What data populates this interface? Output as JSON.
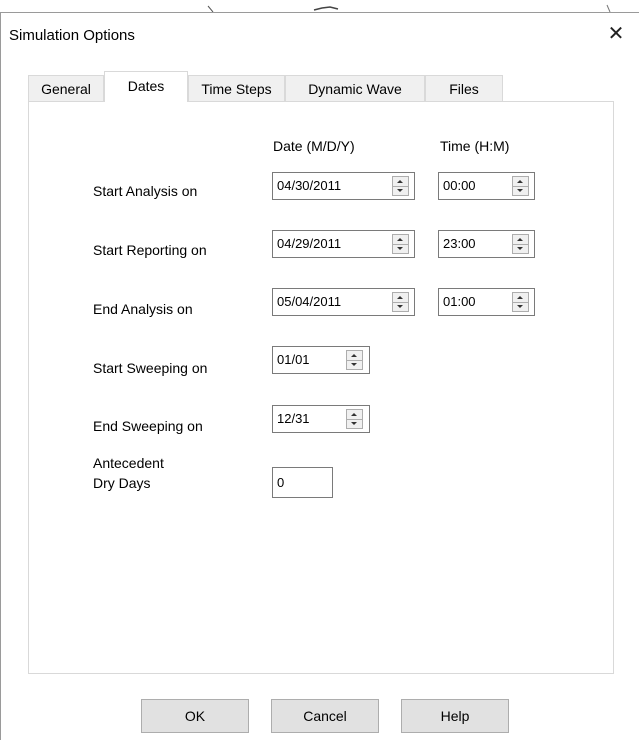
{
  "window": {
    "title": "Simulation Options",
    "close_glyph": "✕"
  },
  "tabs": [
    {
      "label": "General"
    },
    {
      "label": "Dates",
      "active": true
    },
    {
      "label": "Time Steps"
    },
    {
      "label": "Dynamic Wave"
    },
    {
      "label": "Files"
    }
  ],
  "dates": {
    "date_header": "Date (M/D/Y)",
    "time_header": "Time (H:M)",
    "start_analysis": {
      "label": "Start Analysis on",
      "date": "04/30/2011",
      "time": "00:00"
    },
    "start_reporting": {
      "label": "Start Reporting on",
      "date": "04/29/2011",
      "time": "23:00"
    },
    "end_analysis": {
      "label": "End Analysis on",
      "date": "05/04/2011",
      "time": "01:00"
    },
    "start_sweeping": {
      "label": "Start Sweeping on",
      "date": "01/01"
    },
    "end_sweeping": {
      "label": "End Sweeping on",
      "date": "12/31"
    },
    "antecedent": {
      "label_line1": "Antecedent",
      "label_line2": "Dry Days",
      "value": "0"
    }
  },
  "buttons": {
    "ok": "OK",
    "cancel": "Cancel",
    "help": "Help"
  },
  "icons": {
    "close": "close-icon",
    "spin": "spin-up-down-icon"
  }
}
